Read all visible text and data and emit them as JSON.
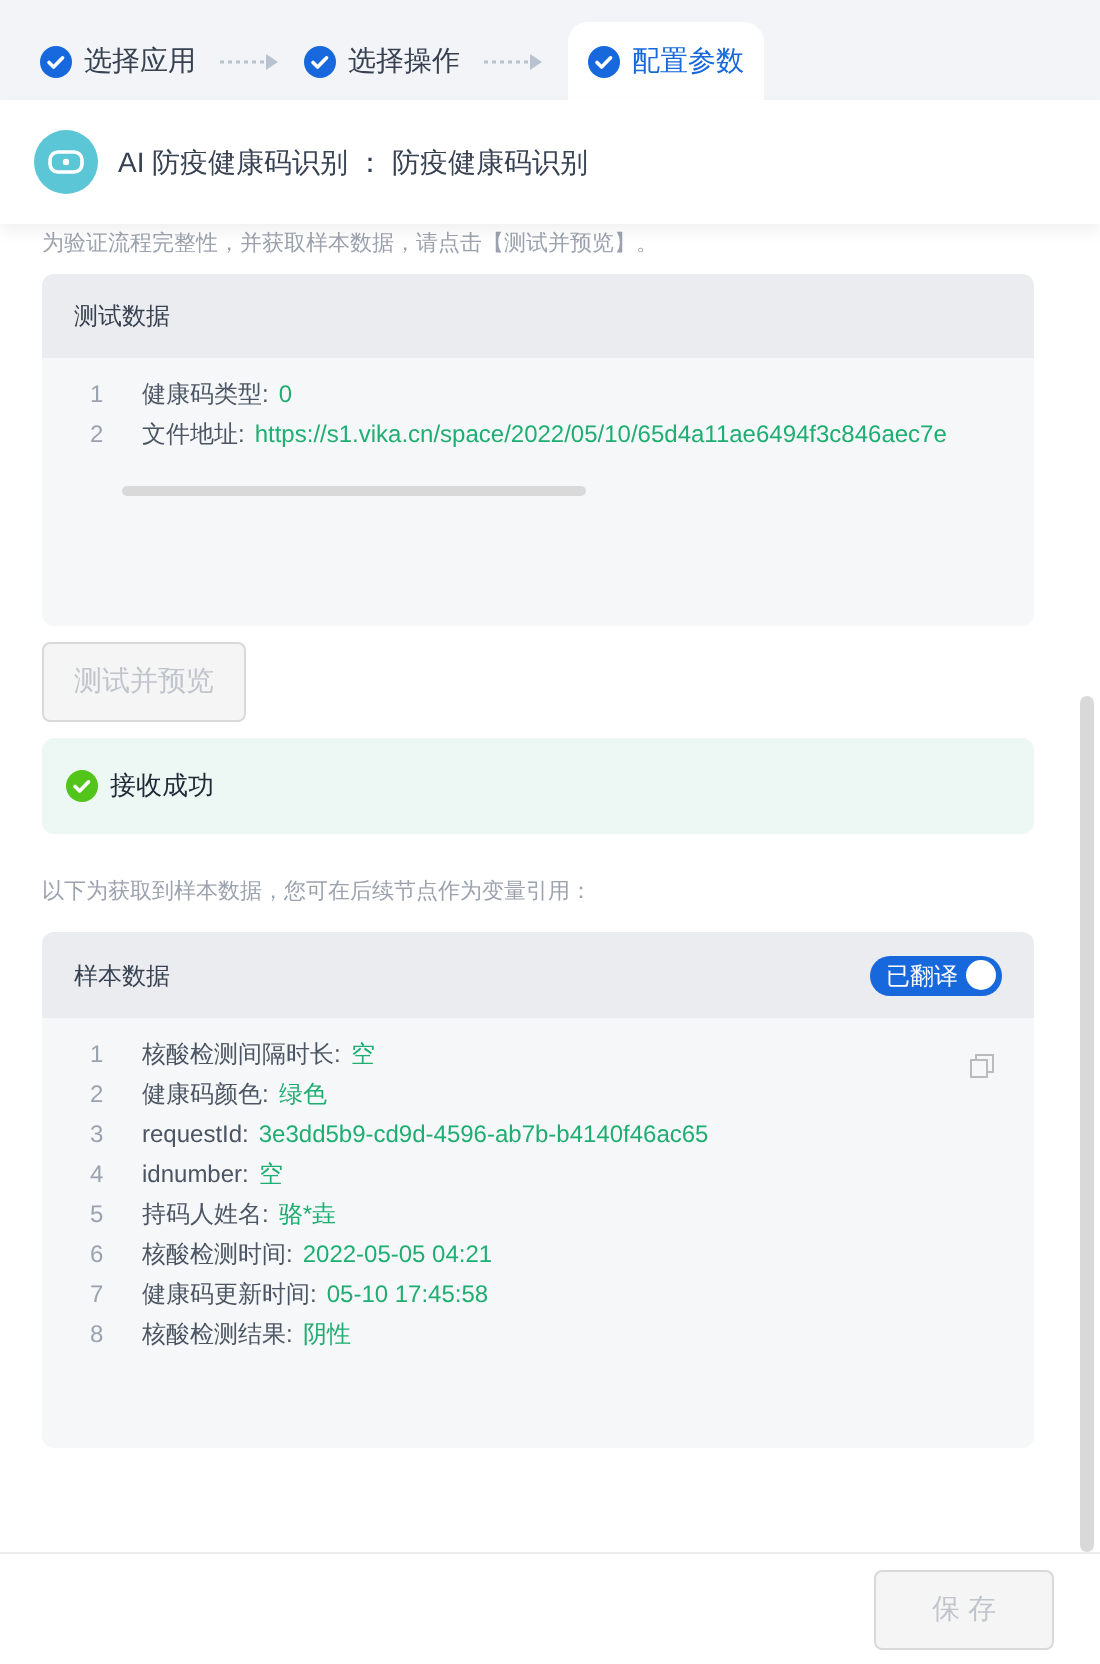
{
  "steps": [
    {
      "label": "选择应用",
      "selected": false
    },
    {
      "label": "选择操作",
      "selected": false
    },
    {
      "label": "配置参数",
      "selected": true
    }
  ],
  "header": {
    "title": "AI 防疫健康码识别 ： 防疫健康码识别"
  },
  "intro": "为验证流程完整性，并获取样本数据，请点击【测试并预览】。",
  "test_data": {
    "title": "测试数据",
    "lines": [
      {
        "number": "1",
        "label": "健康码类型:",
        "value": "0"
      },
      {
        "number": "2",
        "label": "文件地址:",
        "value": "https://s1.vika.cn/space/2022/05/10/65d4a11ae6494f3c846aec7e"
      }
    ]
  },
  "test_button": {
    "label": "测试并预览",
    "disabled": true
  },
  "status": {
    "text": "接收成功"
  },
  "sample_intro": "以下为获取到样本数据，您可在后续节点作为变量引用：",
  "sample_data": {
    "title": "样本数据",
    "toggle": {
      "label": "已翻译",
      "on": true
    },
    "lines": [
      {
        "number": "1",
        "label": "核酸检测间隔时长:",
        "value": "空"
      },
      {
        "number": "2",
        "label": "健康码颜色:",
        "value": "绿色"
      },
      {
        "number": "3",
        "label": "requestId:",
        "value": "3e3dd5b9-cd9d-4596-ab7b-b4140f46ac65"
      },
      {
        "number": "4",
        "label": "idnumber:",
        "value": "空"
      },
      {
        "number": "5",
        "label": "持码人姓名:",
        "value": "骆*垚"
      },
      {
        "number": "6",
        "label": "核酸检测时间:",
        "value": "2022-05-05 04:21"
      },
      {
        "number": "7",
        "label": "健康码更新时间:",
        "value": "05-10 17:45:58"
      },
      {
        "number": "8",
        "label": "核酸检测结果:",
        "value": "阴性"
      }
    ]
  },
  "save_button": {
    "label": "保 存",
    "disabled": true
  }
}
